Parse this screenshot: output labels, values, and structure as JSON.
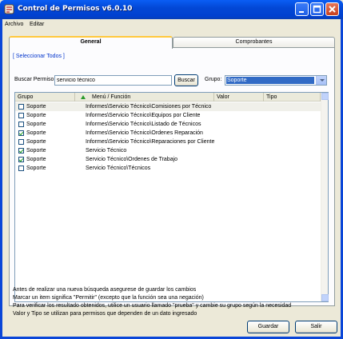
{
  "window": {
    "title": "Control de Permisos v6.0.10"
  },
  "menu": [
    "Archivo",
    "Editar"
  ],
  "tabs": [
    {
      "label": "General"
    },
    {
      "label": "Comprobantes"
    }
  ],
  "select_all_link": "[ Seleccionar Todos ]",
  "search": {
    "label": "Buscar Permiso:",
    "value": "servicio técnico",
    "button": "Buscar"
  },
  "group": {
    "label": "Grupo:",
    "value": "Soporte"
  },
  "grid": {
    "columns": [
      "Grupo",
      "Menú / Función",
      "Valor",
      "Tipo"
    ],
    "rows": [
      {
        "checked": false,
        "group": "Soporte",
        "function": "Informes\\Servicio Técnico\\Comisiones por Técnico"
      },
      {
        "checked": false,
        "group": "Soporte",
        "function": "Informes\\Servicio Técnico\\Equipos por Cliente"
      },
      {
        "checked": false,
        "group": "Soporte",
        "function": "Informes\\Servicio Técnico\\Listado de Técnicos"
      },
      {
        "checked": true,
        "group": "Soporte",
        "function": "Informes\\Servicio Técnico\\Ordenes Reparación"
      },
      {
        "checked": false,
        "group": "Soporte",
        "function": "Informes\\Servicio Técnico\\Reparaciones por Cliente"
      },
      {
        "checked": true,
        "group": "Soporte",
        "function": "Servicio Técnico"
      },
      {
        "checked": true,
        "group": "Soporte",
        "function": "Servicio Técnico\\Ordenes de Trabajo"
      },
      {
        "checked": false,
        "group": "Soporte",
        "function": "Servicio Técnico\\Técnicos"
      }
    ]
  },
  "notes": [
    "Antes de realizar una nueva búsqueda asegurese de guardar los cambios",
    "Marcar un item significa \"Permitir\" (excepto que la función sea una negación)",
    "Para verificar los resultado obtenidos, utilice un usuario llamado \"prueba\" y cambie su grupo según la necesidad",
    "Valor y Tipo se utilizan para permisos que dependen de un dato ingresado"
  ],
  "buttons": {
    "save": "Guardar",
    "exit": "Salir"
  },
  "colors": {
    "titlebar": "#0348d6",
    "selection": "#316ac5",
    "face": "#ece9d8"
  }
}
